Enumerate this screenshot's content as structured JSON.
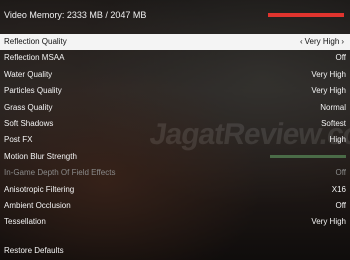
{
  "video_memory": {
    "label": "Video Memory: 2333 MB / 2047 MB",
    "usage_fraction": 1.0,
    "bar_color": "#e0342e"
  },
  "settings": [
    {
      "label": "Reflection Quality",
      "value": "Very High",
      "selected": true
    },
    {
      "label": "Reflection MSAA",
      "value": "Off"
    },
    {
      "label": "Water Quality",
      "value": "Very High"
    },
    {
      "label": "Particles Quality",
      "value": "Very High"
    },
    {
      "label": "Grass Quality",
      "value": "Normal"
    },
    {
      "label": "Soft Shadows",
      "value": "Softest"
    },
    {
      "label": "Post FX",
      "value": "High"
    },
    {
      "label": "Motion Blur Strength",
      "slider_fraction": 1.0,
      "slider_color": "#4a6b47"
    },
    {
      "label": "In-Game Depth Of Field Effects",
      "value": "Off",
      "disabled": true
    },
    {
      "label": "Anisotropic Filtering",
      "value": "X16"
    },
    {
      "label": "Ambient Occlusion",
      "value": "Off"
    },
    {
      "label": "Tessellation",
      "value": "Very High"
    }
  ],
  "selector_arrows": {
    "left": "‹",
    "right": "›"
  },
  "restore_defaults": "Restore Defaults",
  "watermark": "JagatReview.com",
  "colors": {
    "selected_bg": "#f4f4f4",
    "selected_text": "#111111",
    "disabled_text": "#8a8a8a"
  }
}
